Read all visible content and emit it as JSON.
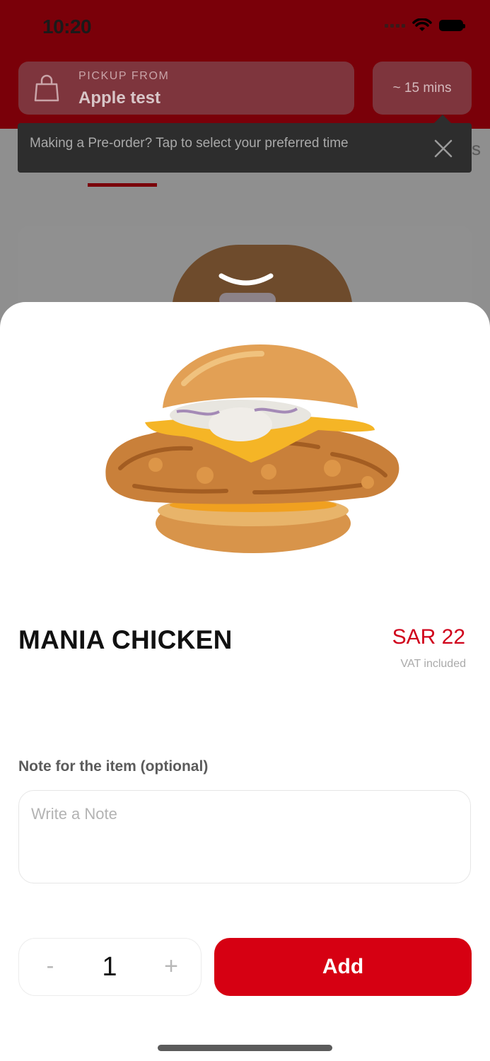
{
  "status_bar": {
    "time": "10:20"
  },
  "header": {
    "pickup_label": "PICKUP FROM",
    "store_name": "Apple test",
    "eta": "~ 15 mins"
  },
  "tooltip": {
    "text": "Making a Pre-order? Tap to select your preferred time"
  },
  "background_tabs": {
    "partial_label": "s"
  },
  "product": {
    "name": "MANIA CHICKEN",
    "price": "SAR 22",
    "vat_note": "VAT included"
  },
  "note": {
    "label": "Note for the item (optional)",
    "placeholder": "Write a Note",
    "value": ""
  },
  "quantity": {
    "minus_label": "-",
    "value": "1",
    "plus_label": "+"
  },
  "actions": {
    "add_label": "Add"
  },
  "colors": {
    "brand_red": "#d60012",
    "header_red": "#7a0009",
    "price_red": "#d0021b"
  },
  "icons": [
    "shopping-bag-icon",
    "close-icon",
    "chevron-down-icon",
    "wifi-icon",
    "battery-icon",
    "signal-icon"
  ]
}
